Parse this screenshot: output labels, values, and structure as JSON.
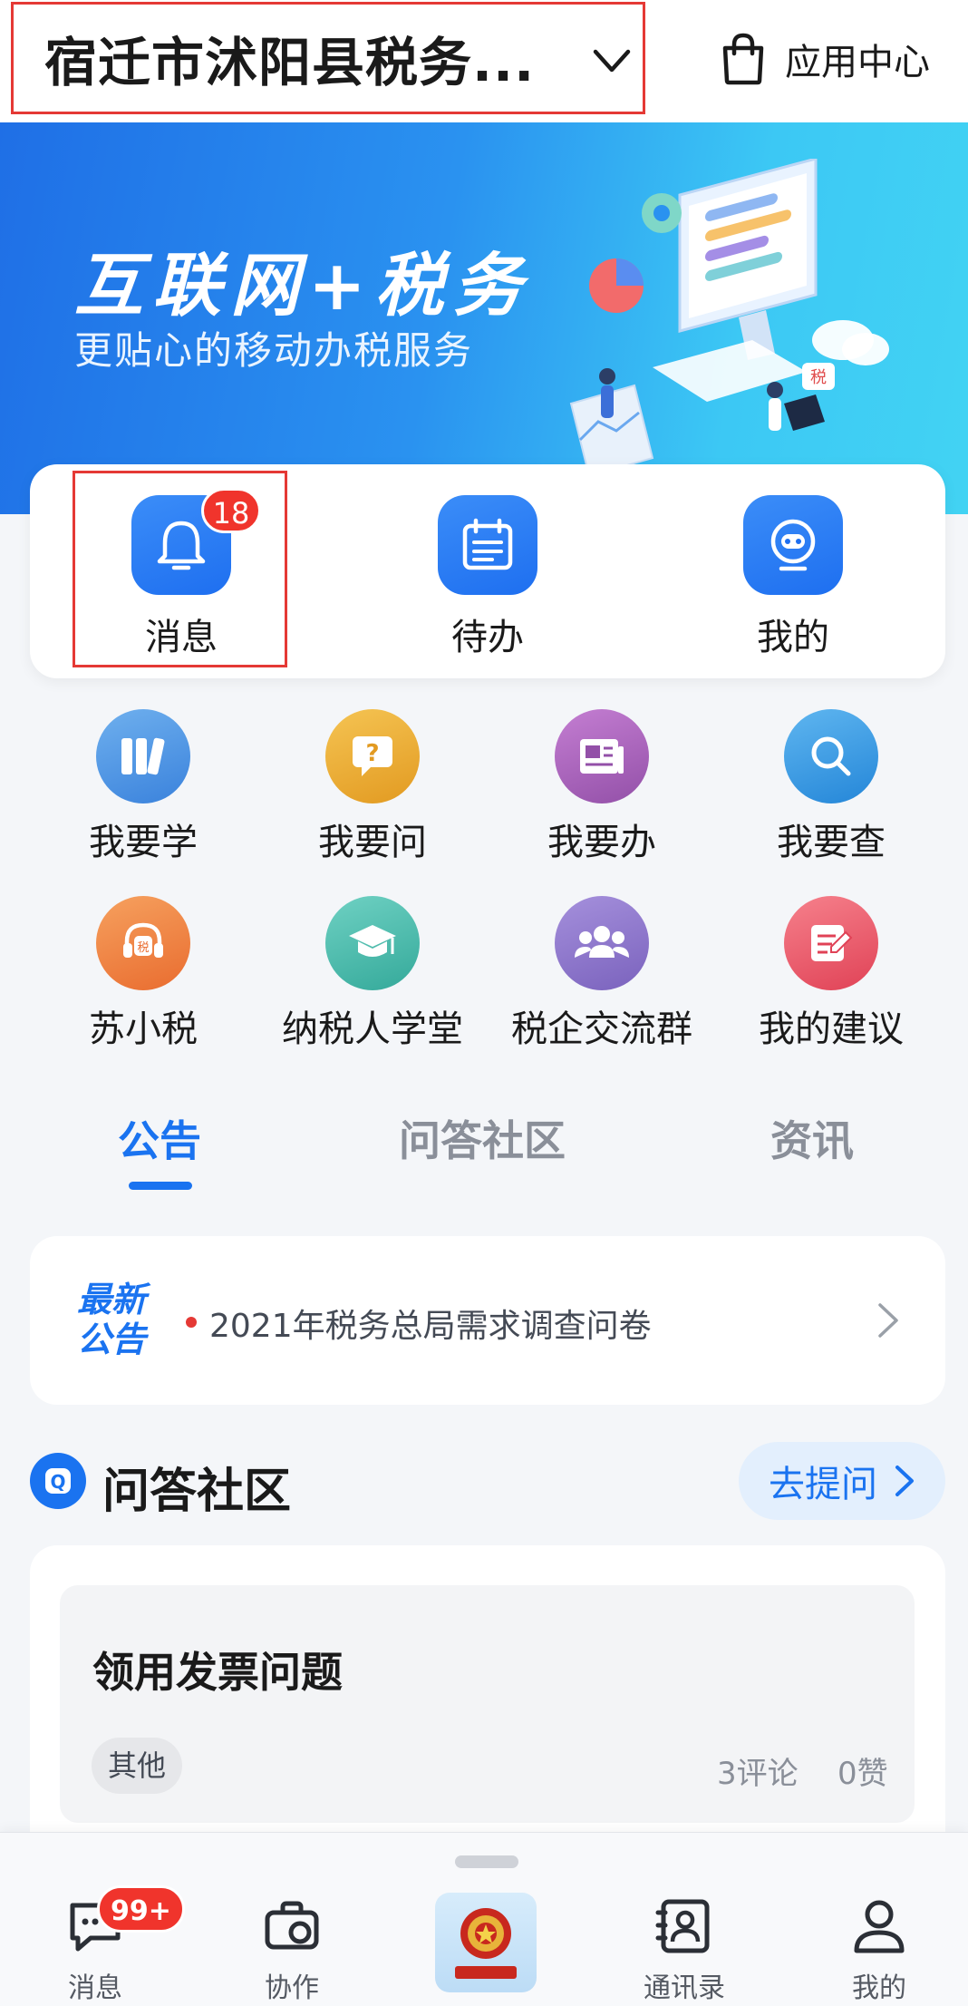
{
  "header": {
    "org_name": "宿迁市沭阳县税务...",
    "app_center_label": "应用中心"
  },
  "banner": {
    "title": "互联网+税务",
    "subtitle": "更贴心的移动办税服务"
  },
  "quick_actions": [
    {
      "label": "消息",
      "badge": "18",
      "icon": "bell-icon"
    },
    {
      "label": "待办",
      "icon": "calendar-icon"
    },
    {
      "label": "我的",
      "icon": "robot-icon"
    }
  ],
  "services": [
    {
      "label": "我要学",
      "icon": "books-icon",
      "color": "#3f8de2"
    },
    {
      "label": "我要问",
      "icon": "question-chat-icon",
      "color": "#e8a62c"
    },
    {
      "label": "我要办",
      "icon": "newspaper-icon",
      "color": "#a25fb3"
    },
    {
      "label": "我要查",
      "icon": "search-icon",
      "color": "#3497e0"
    },
    {
      "label": "苏小税",
      "icon": "headset-icon",
      "color": "#ef8040"
    },
    {
      "label": "纳税人学堂",
      "icon": "graduation-cap-icon",
      "color": "#3fb5a6"
    },
    {
      "label": "税企交流群",
      "icon": "group-icon",
      "color": "#8a72c6"
    },
    {
      "label": "我的建议",
      "icon": "edit-note-icon",
      "color": "#ee5b6a"
    }
  ],
  "tabs": [
    {
      "label": "公告",
      "active": true
    },
    {
      "label": "问答社区",
      "active": false
    },
    {
      "label": "资讯",
      "active": false
    }
  ],
  "notice": {
    "tag_line1": "最新",
    "tag_line2": "公告",
    "text": "2021年税务总局需求调查问卷"
  },
  "qa": {
    "title": "问答社区",
    "logo_letter": "Q",
    "ask_label": "去提问",
    "post": {
      "title": "领用发票问题",
      "tag": "其他",
      "comments": "3评论",
      "likes": "0赞"
    }
  },
  "bottom_nav": [
    {
      "label": "消息",
      "badge": "99+",
      "icon": "chat-icon"
    },
    {
      "label": "协作",
      "icon": "briefcase-icon"
    },
    {
      "label": "",
      "icon": "tax-emblem-icon"
    },
    {
      "label": "通讯录",
      "icon": "contacts-icon"
    },
    {
      "label": "我的",
      "icon": "person-icon"
    }
  ],
  "colors": {
    "accent": "#1a73f0",
    "badge": "#f0342c",
    "highlight_outline": "#e53935"
  }
}
